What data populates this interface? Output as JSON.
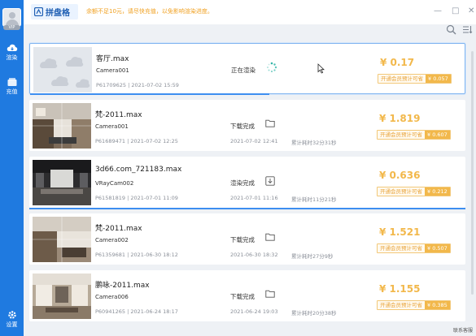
{
  "sidebar": {
    "vip_badge": "VIP",
    "items": [
      {
        "label": "渲染",
        "icon": "cloud-render-icon"
      },
      {
        "label": "充值",
        "icon": "wallet-icon"
      }
    ],
    "settings_label": "设置"
  },
  "header": {
    "logo_text": "拼盘格",
    "notice": "余额不足10元，请尽快充值，以免影响渲染进度。",
    "window_buttons": [
      "—",
      "□",
      "✕"
    ]
  },
  "colors": {
    "accent": "#1f7ae0",
    "price": "#f2b84b",
    "notice": "#f0a020"
  },
  "jobs": [
    {
      "name": "客厅.max",
      "camera": "Camera001",
      "meta": "P61709625 | 2021-07-02 15:59",
      "status": "正在渲染",
      "status_icon": "spinner-icon",
      "done_time": "",
      "elapsed": "",
      "price": "¥ 0.17",
      "tag_label": "开通会员预计可省",
      "tag_value": "¥ 0.057",
      "progress": 0.55
    },
    {
      "name": "梵-2011.max",
      "camera": "Camera001",
      "meta": "P61689471 | 2021-07-02 12:25",
      "status": "下载完成",
      "status_icon": "folder-icon",
      "done_time": "2021-07-02 12:41",
      "elapsed": "累计耗时32分31秒",
      "price": "¥ 1.819",
      "tag_label": "开通会员预计可省",
      "tag_value": "¥ 0.607"
    },
    {
      "name": "3d66.com_721183.max",
      "camera": "VRayCam002",
      "meta": "P61581819 | 2021-07-01 11:09",
      "status": "渲染完成",
      "status_icon": "download-icon",
      "done_time": "2021-07-01 11:16",
      "elapsed": "累计耗时11分21秒",
      "price": "¥ 0.636",
      "tag_label": "开通会员预计可省",
      "tag_value": "¥ 0.212",
      "progress": 1
    },
    {
      "name": "梵-2011.max",
      "camera": "Camera002",
      "meta": "P61359681 | 2021-06-30 18:12",
      "status": "下载完成",
      "status_icon": "folder-icon",
      "done_time": "2021-06-30 18:32",
      "elapsed": "累计耗时27分9秒",
      "price": "¥ 1.521",
      "tag_label": "开通会员预计可省",
      "tag_value": "¥ 0.507"
    },
    {
      "name": "鹏咏-2011.max",
      "camera": "Camera006",
      "meta": "P60941265 | 2021-06-24 18:17",
      "status": "下载完成",
      "status_icon": "folder-icon",
      "done_time": "2021-06-24 19:03",
      "elapsed": "累计耗时20分38秒",
      "price": "¥ 1.155",
      "tag_label": "开通会员预计可省",
      "tag_value": "¥ 0.385"
    }
  ],
  "footer": {
    "corner_text": "联系客服"
  }
}
